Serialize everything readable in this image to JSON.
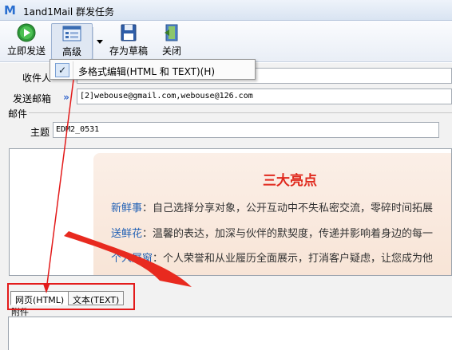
{
  "window": {
    "title": "1and1Mail 群发任务",
    "app_icon": "M"
  },
  "toolbar": {
    "send_now": "立即发送",
    "advanced": "高级",
    "save_draft": "存为草稿",
    "close": "关闭"
  },
  "menu": {
    "item_label": "多格式编辑(HTML 和 TEXT)(H)",
    "checked": true
  },
  "form": {
    "recipient_label": "收件人",
    "sender_label": "发送邮箱",
    "sender_value": "[2]webouse@gmail.com,webouse@126.com",
    "mail_group_label": "邮件",
    "subject_label": "主题",
    "subject_value": "EDM2_0531",
    "attachment_label": "附件"
  },
  "editor": {
    "headline": "三大亮点",
    "lines": [
      {
        "key": "新鲜事",
        "text": "：自己选择分享对象，公开互动中不失私密交流，零碎时间拓展"
      },
      {
        "key": "送鲜花",
        "text": "：温馨的表达，加深与伙伴的默契度，传递并影响着身边的每一"
      },
      {
        "key": "个人展窗",
        "text": "：个人荣誉和从业履历全面展示，打消客户疑虑，让您成为他"
      }
    ]
  },
  "tabs": {
    "html": "网页(HTML)",
    "text": "文本(TEXT)"
  },
  "colors": {
    "annotation_red": "#e31b1b",
    "headline_red": "#e0291d",
    "key_blue": "#1f5fb4"
  }
}
